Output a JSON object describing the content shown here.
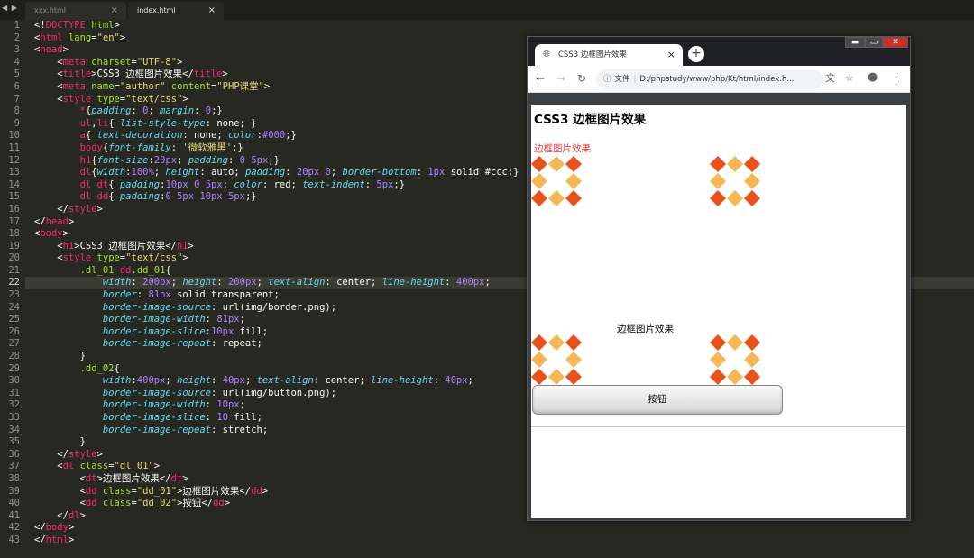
{
  "editor": {
    "tabs": [
      {
        "label": "xxx.html",
        "active": false
      },
      {
        "label": "index.html",
        "active": true
      }
    ],
    "current_line": 22,
    "lines": [
      [
        [
          "t-txt",
          "<!"
        ],
        [
          "t-tag",
          "DOCTYPE"
        ],
        [
          "t-txt",
          " "
        ],
        [
          "t-att",
          "html"
        ],
        [
          "t-txt",
          ">"
        ]
      ],
      [
        [
          "t-txt",
          "<"
        ],
        [
          "t-tag",
          "html"
        ],
        [
          "t-txt",
          " "
        ],
        [
          "t-att",
          "lang"
        ],
        [
          "t-txt",
          "="
        ],
        [
          "t-str",
          "\"en\""
        ],
        [
          "t-txt",
          ">"
        ]
      ],
      [
        [
          "t-txt",
          "<"
        ],
        [
          "t-tag",
          "head"
        ],
        [
          "t-txt",
          ">"
        ]
      ],
      [
        [
          "t-txt",
          "    <"
        ],
        [
          "t-tag",
          "meta"
        ],
        [
          "t-txt",
          " "
        ],
        [
          "t-att",
          "charset"
        ],
        [
          "t-txt",
          "="
        ],
        [
          "t-str",
          "\"UTF-8\""
        ],
        [
          "t-txt",
          ">"
        ]
      ],
      [
        [
          "t-txt",
          "    <"
        ],
        [
          "t-tag",
          "title"
        ],
        [
          "t-txt",
          ">CSS3 边框图片效果</"
        ],
        [
          "t-tag",
          "title"
        ],
        [
          "t-txt",
          ">"
        ]
      ],
      [
        [
          "t-txt",
          "    <"
        ],
        [
          "t-tag",
          "meta"
        ],
        [
          "t-txt",
          " "
        ],
        [
          "t-att",
          "name"
        ],
        [
          "t-txt",
          "="
        ],
        [
          "t-str",
          "\"author\""
        ],
        [
          "t-txt",
          " "
        ],
        [
          "t-att",
          "content"
        ],
        [
          "t-txt",
          "="
        ],
        [
          "t-str",
          "\"PHP课堂\""
        ],
        [
          "t-txt",
          ">"
        ]
      ],
      [
        [
          "t-txt",
          "    <"
        ],
        [
          "t-tag",
          "style"
        ],
        [
          "t-txt",
          " "
        ],
        [
          "t-att",
          "type"
        ],
        [
          "t-txt",
          "="
        ],
        [
          "t-str",
          "\"text/css\""
        ],
        [
          "t-txt",
          ">"
        ]
      ],
      [
        [
          "t-txt",
          "        "
        ],
        [
          "t-sel",
          "*"
        ],
        [
          "t-txt",
          "{"
        ],
        [
          "t-prop",
          "padding"
        ],
        [
          "t-txt",
          ": "
        ],
        [
          "t-num",
          "0"
        ],
        [
          "t-txt",
          "; "
        ],
        [
          "t-prop",
          "margin"
        ],
        [
          "t-txt",
          ": "
        ],
        [
          "t-num",
          "0"
        ],
        [
          "t-txt",
          ";}"
        ]
      ],
      [
        [
          "t-txt",
          "        "
        ],
        [
          "t-sel",
          "ul"
        ],
        [
          "t-txt",
          ","
        ],
        [
          "t-sel",
          "li"
        ],
        [
          "t-txt",
          "{ "
        ],
        [
          "t-prop",
          "list-style-type"
        ],
        [
          "t-txt",
          ": none; }"
        ]
      ],
      [
        [
          "t-txt",
          "        "
        ],
        [
          "t-sel",
          "a"
        ],
        [
          "t-txt",
          "{ "
        ],
        [
          "t-prop",
          "text-decoration"
        ],
        [
          "t-txt",
          ": none; "
        ],
        [
          "t-prop",
          "color"
        ],
        [
          "t-txt",
          ":"
        ],
        [
          "t-num",
          "#000"
        ],
        [
          "t-txt",
          ";}"
        ]
      ],
      [
        [
          "t-txt",
          "        "
        ],
        [
          "t-sel",
          "body"
        ],
        [
          "t-txt",
          "{"
        ],
        [
          "t-prop",
          "font-family"
        ],
        [
          "t-txt",
          ": "
        ],
        [
          "t-str",
          "'微软雅黑'"
        ],
        [
          "t-txt",
          ";}"
        ]
      ],
      [
        [
          "t-txt",
          "        "
        ],
        [
          "t-sel",
          "h1"
        ],
        [
          "t-txt",
          "{"
        ],
        [
          "t-prop",
          "font-size"
        ],
        [
          "t-txt",
          ":"
        ],
        [
          "t-num",
          "20px"
        ],
        [
          "t-txt",
          "; "
        ],
        [
          "t-prop",
          "padding"
        ],
        [
          "t-txt",
          ": "
        ],
        [
          "t-num",
          "0"
        ],
        [
          "t-txt",
          " "
        ],
        [
          "t-num",
          "5px"
        ],
        [
          "t-txt",
          ";}"
        ]
      ],
      [
        [
          "t-txt",
          "        "
        ],
        [
          "t-sel",
          "dl"
        ],
        [
          "t-txt",
          "{"
        ],
        [
          "t-prop",
          "width"
        ],
        [
          "t-txt",
          ":"
        ],
        [
          "t-num",
          "100%"
        ],
        [
          "t-txt",
          "; "
        ],
        [
          "t-prop",
          "height"
        ],
        [
          "t-txt",
          ": auto; "
        ],
        [
          "t-prop",
          "padding"
        ],
        [
          "t-txt",
          ": "
        ],
        [
          "t-num",
          "20px"
        ],
        [
          "t-txt",
          " "
        ],
        [
          "t-num",
          "0"
        ],
        [
          "t-txt",
          "; "
        ],
        [
          "t-prop",
          "border-bottom"
        ],
        [
          "t-txt",
          ": "
        ],
        [
          "t-num",
          "1px"
        ],
        [
          "t-txt",
          " solid #ccc;}"
        ]
      ],
      [
        [
          "t-txt",
          "        "
        ],
        [
          "t-sel",
          "dl dt"
        ],
        [
          "t-txt",
          "{ "
        ],
        [
          "t-prop",
          "padding"
        ],
        [
          "t-txt",
          ":"
        ],
        [
          "t-num",
          "10px"
        ],
        [
          "t-txt",
          " "
        ],
        [
          "t-num",
          "0"
        ],
        [
          "t-txt",
          " "
        ],
        [
          "t-num",
          "5px"
        ],
        [
          "t-txt",
          "; "
        ],
        [
          "t-prop",
          "color"
        ],
        [
          "t-txt",
          ": red; "
        ],
        [
          "t-prop",
          "text-indent"
        ],
        [
          "t-txt",
          ": "
        ],
        [
          "t-num",
          "5px"
        ],
        [
          "t-txt",
          ";}"
        ]
      ],
      [
        [
          "t-txt",
          "        "
        ],
        [
          "t-sel",
          "dl dd"
        ],
        [
          "t-txt",
          "{ "
        ],
        [
          "t-prop",
          "padding"
        ],
        [
          "t-txt",
          ":"
        ],
        [
          "t-num",
          "0"
        ],
        [
          "t-txt",
          " "
        ],
        [
          "t-num",
          "5px"
        ],
        [
          "t-txt",
          " "
        ],
        [
          "t-num",
          "10px"
        ],
        [
          "t-txt",
          " "
        ],
        [
          "t-num",
          "5px"
        ],
        [
          "t-txt",
          ";}"
        ]
      ],
      [
        [
          "t-txt",
          "    </"
        ],
        [
          "t-tag",
          "style"
        ],
        [
          "t-txt",
          ">"
        ]
      ],
      [
        [
          "t-txt",
          "</"
        ],
        [
          "t-tag",
          "head"
        ],
        [
          "t-txt",
          ">"
        ]
      ],
      [
        [
          "t-txt",
          "<"
        ],
        [
          "t-tag",
          "body"
        ],
        [
          "t-txt",
          ">"
        ]
      ],
      [
        [
          "t-txt",
          "    <"
        ],
        [
          "t-tag",
          "h1"
        ],
        [
          "t-txt",
          ">CSS3 边框图片效果</"
        ],
        [
          "t-tag",
          "h1"
        ],
        [
          "t-txt",
          ">"
        ]
      ],
      [
        [
          "t-txt",
          "    <"
        ],
        [
          "t-tag",
          "style"
        ],
        [
          "t-txt",
          " "
        ],
        [
          "t-att",
          "type"
        ],
        [
          "t-txt",
          "="
        ],
        [
          "t-str",
          "\"text/css\""
        ],
        [
          "t-txt",
          ">"
        ]
      ],
      [
        [
          "t-txt",
          "        "
        ],
        [
          "t-att",
          ".dl_01"
        ],
        [
          "t-txt",
          " "
        ],
        [
          "t-sel",
          "dd"
        ],
        [
          "t-att",
          ".dd_01"
        ],
        [
          "t-txt",
          "{"
        ]
      ],
      [
        [
          "t-txt",
          "            "
        ],
        [
          "t-prop",
          "width"
        ],
        [
          "t-txt",
          ": "
        ],
        [
          "t-num",
          "200px"
        ],
        [
          "t-txt",
          "; "
        ],
        [
          "t-prop",
          "height"
        ],
        [
          "t-txt",
          ": "
        ],
        [
          "t-num",
          "200px"
        ],
        [
          "t-txt",
          "; "
        ],
        [
          "t-prop",
          "text-align"
        ],
        [
          "t-txt",
          ": center; "
        ],
        [
          "t-prop",
          "line-height"
        ],
        [
          "t-txt",
          ": "
        ],
        [
          "t-num",
          "400px"
        ],
        [
          "t-txt",
          ";"
        ]
      ],
      [
        [
          "t-txt",
          "            "
        ],
        [
          "t-prop",
          "border"
        ],
        [
          "t-txt",
          ": "
        ],
        [
          "t-num",
          "81px"
        ],
        [
          "t-txt",
          " solid transparent;"
        ]
      ],
      [
        [
          "t-txt",
          "            "
        ],
        [
          "t-prop",
          "border-image-source"
        ],
        [
          "t-txt",
          ": url(img/border.png);"
        ]
      ],
      [
        [
          "t-txt",
          "            "
        ],
        [
          "t-prop",
          "border-image-width"
        ],
        [
          "t-txt",
          ": "
        ],
        [
          "t-num",
          "81px"
        ],
        [
          "t-txt",
          ";"
        ]
      ],
      [
        [
          "t-txt",
          "            "
        ],
        [
          "t-prop",
          "border-image-slice"
        ],
        [
          "t-txt",
          ":"
        ],
        [
          "t-num",
          "10px"
        ],
        [
          "t-txt",
          " fill;"
        ]
      ],
      [
        [
          "t-txt",
          "            "
        ],
        [
          "t-prop",
          "border-image-repeat"
        ],
        [
          "t-txt",
          ": repeat;"
        ]
      ],
      [
        [
          "t-txt",
          "        }"
        ]
      ],
      [
        [
          "t-txt",
          "        "
        ],
        [
          "t-att",
          ".dd_02"
        ],
        [
          "t-txt",
          "{"
        ]
      ],
      [
        [
          "t-txt",
          "            "
        ],
        [
          "t-prop",
          "width"
        ],
        [
          "t-txt",
          ":"
        ],
        [
          "t-num",
          "400px"
        ],
        [
          "t-txt",
          "; "
        ],
        [
          "t-prop",
          "height"
        ],
        [
          "t-txt",
          ": "
        ],
        [
          "t-num",
          "40px"
        ],
        [
          "t-txt",
          "; "
        ],
        [
          "t-prop",
          "text-align"
        ],
        [
          "t-txt",
          ": center; "
        ],
        [
          "t-prop",
          "line-height"
        ],
        [
          "t-txt",
          ": "
        ],
        [
          "t-num",
          "40px"
        ],
        [
          "t-txt",
          ";"
        ]
      ],
      [
        [
          "t-txt",
          "            "
        ],
        [
          "t-prop",
          "border-image-source"
        ],
        [
          "t-txt",
          ": url(img/button.png);"
        ]
      ],
      [
        [
          "t-txt",
          "            "
        ],
        [
          "t-prop",
          "border-image-width"
        ],
        [
          "t-txt",
          ": "
        ],
        [
          "t-num",
          "10px"
        ],
        [
          "t-txt",
          ";"
        ]
      ],
      [
        [
          "t-txt",
          "            "
        ],
        [
          "t-prop",
          "border-image-slice"
        ],
        [
          "t-txt",
          ": "
        ],
        [
          "t-num",
          "10"
        ],
        [
          "t-txt",
          " fill;"
        ]
      ],
      [
        [
          "t-txt",
          "            "
        ],
        [
          "t-prop",
          "border-image-repeat"
        ],
        [
          "t-txt",
          ": stretch;"
        ]
      ],
      [
        [
          "t-txt",
          "        }"
        ]
      ],
      [
        [
          "t-txt",
          "    </"
        ],
        [
          "t-tag",
          "style"
        ],
        [
          "t-txt",
          ">"
        ]
      ],
      [
        [
          "t-txt",
          "    <"
        ],
        [
          "t-tag",
          "dl"
        ],
        [
          "t-txt",
          " "
        ],
        [
          "t-att",
          "class"
        ],
        [
          "t-txt",
          "="
        ],
        [
          "t-str",
          "\"dl_01\""
        ],
        [
          "t-txt",
          ">"
        ]
      ],
      [
        [
          "t-txt",
          "        <"
        ],
        [
          "t-tag",
          "dt"
        ],
        [
          "t-txt",
          ">边框图片效果</"
        ],
        [
          "t-tag",
          "dt"
        ],
        [
          "t-txt",
          ">"
        ]
      ],
      [
        [
          "t-txt",
          "        <"
        ],
        [
          "t-tag",
          "dd"
        ],
        [
          "t-txt",
          " "
        ],
        [
          "t-att",
          "class"
        ],
        [
          "t-txt",
          "="
        ],
        [
          "t-str",
          "\"dd_01\""
        ],
        [
          "t-txt",
          ">边框图片效果</"
        ],
        [
          "t-tag",
          "dd"
        ],
        [
          "t-txt",
          ">"
        ]
      ],
      [
        [
          "t-txt",
          "        <"
        ],
        [
          "t-tag",
          "dd"
        ],
        [
          "t-txt",
          " "
        ],
        [
          "t-att",
          "class"
        ],
        [
          "t-txt",
          "="
        ],
        [
          "t-str",
          "\"dd_02\""
        ],
        [
          "t-txt",
          ">按钮</"
        ],
        [
          "t-tag",
          "dd"
        ],
        [
          "t-txt",
          ">"
        ]
      ],
      [
        [
          "t-txt",
          "    </"
        ],
        [
          "t-tag",
          "dl"
        ],
        [
          "t-txt",
          ">"
        ]
      ],
      [
        [
          "t-txt",
          "</"
        ],
        [
          "t-tag",
          "body"
        ],
        [
          "t-txt",
          ">"
        ]
      ],
      [
        [
          "t-txt",
          "</"
        ],
        [
          "t-tag",
          "html"
        ],
        [
          "t-txt",
          ">"
        ]
      ]
    ]
  },
  "browser": {
    "window_controls": {
      "minimize": "▬",
      "maximize": "▭",
      "close": "✕"
    },
    "tab_title": "CSS3 边框图片效果",
    "tab_close": "×",
    "new_tab": "+",
    "nav": {
      "back": "←",
      "forward": "→",
      "reload": "↻"
    },
    "omnibox": {
      "info_icon": "ⓘ",
      "scheme_label": "文件",
      "separator": "|",
      "url": "D:/phpstudy/www/php/Kt/html/index.h..."
    },
    "toolbar_icons": {
      "translate": "文",
      "bookmark": "☆",
      "profile": "●",
      "menu": "⋮"
    },
    "page": {
      "h1": "CSS3 边框图片效果",
      "dt": "边框图片效果",
      "dd1": "边框图片效果",
      "dd2": "按钮"
    },
    "decoration_colors": {
      "dark": "#e8531c",
      "light": "#f6b857"
    }
  }
}
